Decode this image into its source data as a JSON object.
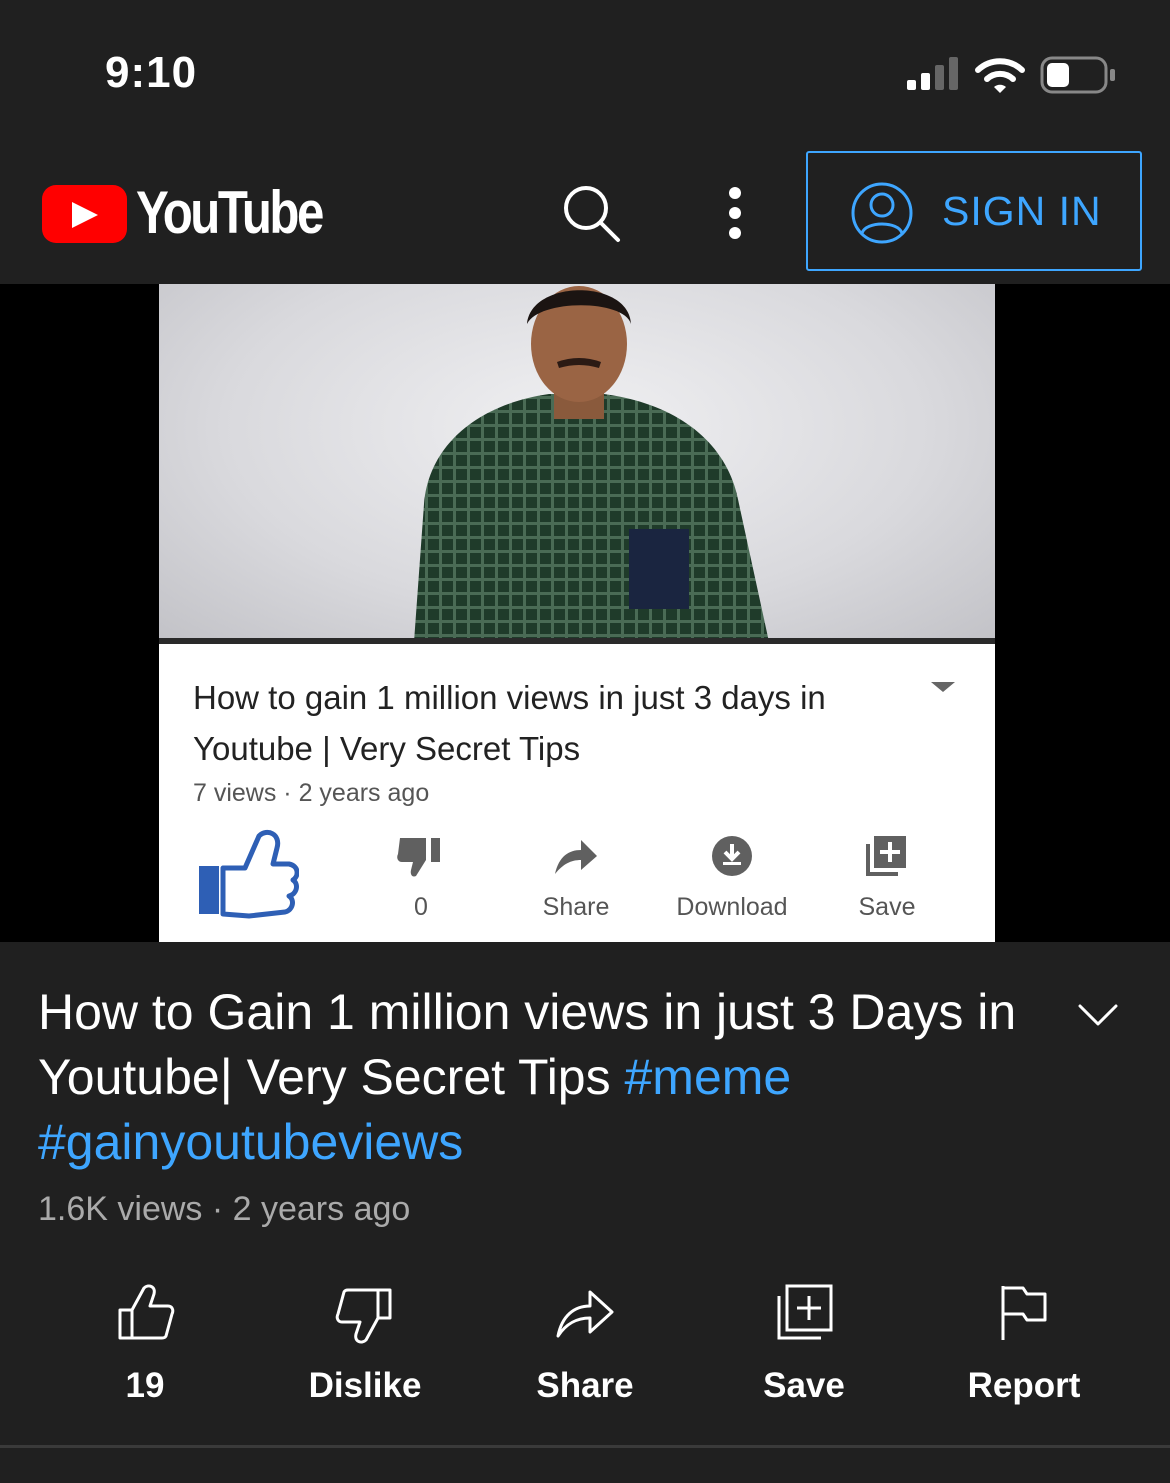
{
  "status_bar": {
    "time": "9:10",
    "icons": [
      "cellular-signal-icon",
      "wifi-icon",
      "battery-icon"
    ]
  },
  "header": {
    "logo_text": "YouTube",
    "icons": [
      "search-icon",
      "more-vert-icon",
      "account-circle-icon"
    ],
    "sign_in_label": "SIGN IN"
  },
  "video_frame": {
    "title": "How to gain 1 million views in just 3 days in Youtube | Very Secret Tips",
    "meta": "7 views · 2 years ago",
    "actions": [
      {
        "icon": "thumbs-up-icon",
        "label": ""
      },
      {
        "icon": "thumbs-down-icon",
        "label": "0"
      },
      {
        "icon": "share-icon",
        "label": "Share"
      },
      {
        "icon": "download-icon",
        "label": "Download"
      },
      {
        "icon": "playlist-add-icon",
        "label": "Save"
      }
    ]
  },
  "video": {
    "title_text": "How to Gain 1 million views in just 3 Days in Youtube| Very Secret Tips ",
    "hashtags": [
      "#meme",
      "#gainyoutubeviews"
    ],
    "meta": "1.6K views · 2 years ago"
  },
  "actions": [
    {
      "icon": "like-icon",
      "label": "19"
    },
    {
      "icon": "dislike-icon",
      "label": "Dislike"
    },
    {
      "icon": "share-icon",
      "label": "Share"
    },
    {
      "icon": "save-playlist-icon",
      "label": "Save"
    },
    {
      "icon": "report-flag-icon",
      "label": "Report"
    }
  ],
  "colors": {
    "background": "#202020",
    "accent_blue": "#3ea6ff",
    "youtube_red": "#ff0000"
  }
}
